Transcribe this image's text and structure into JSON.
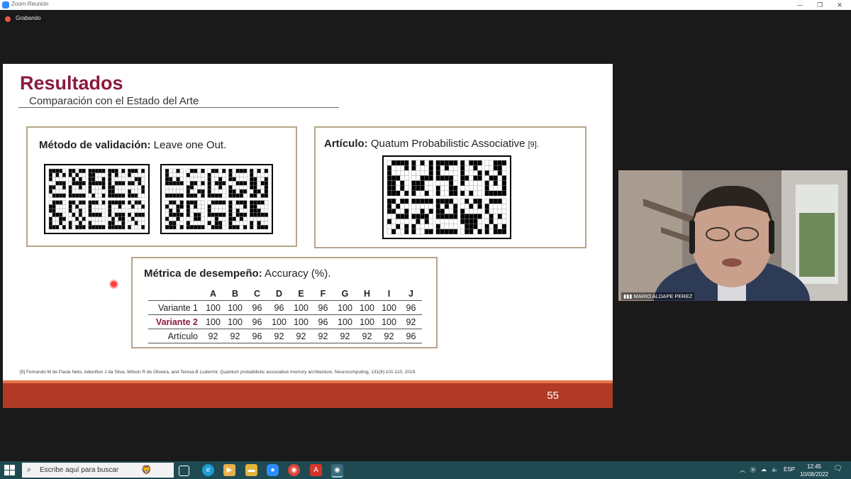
{
  "window": {
    "title": "Zoom Reunión",
    "minimize": "—",
    "restore": "❐",
    "close": "✕"
  },
  "recording": {
    "label": "Grabando"
  },
  "slide": {
    "title": "Resultados",
    "subtitle": "Comparación con el Estado del Arte",
    "validation": {
      "label": "Método de validación:",
      "value": " Leave one Out."
    },
    "article": {
      "label": "Artículo:",
      "value": " Quatum Probabilistic Associative ",
      "ref": "[9]."
    },
    "metric": {
      "label": "Métrica de desempeño:",
      "value": " Accuracy (%)."
    },
    "table": {
      "columns": [
        "A",
        "B",
        "C",
        "D",
        "E",
        "F",
        "G",
        "H",
        "I",
        "J"
      ],
      "rows": [
        {
          "label": "Variante 1",
          "values": [
            "100",
            "100",
            "96",
            "96",
            "100",
            "96",
            "100",
            "100",
            "100",
            "96"
          ]
        },
        {
          "label": "Variante 2",
          "values": [
            "100",
            "100",
            "96",
            "100",
            "100",
            "96",
            "100",
            "100",
            "100",
            "92"
          ]
        },
        {
          "label": "Artículo",
          "values": [
            "92",
            "92",
            "96",
            "92",
            "92",
            "92",
            "92",
            "92",
            "92",
            "96"
          ]
        }
      ]
    },
    "reference": "[9] Fernando M de Paula Neto, Adenilton J da Silva, Wilson R de Oliveira, and Teresa B Ludermir. Quantum probabilistic associative memory architecture. Neurocomputing, 131(8):101-110, 2019.",
    "page_number": "55"
  },
  "video": {
    "participant_name": "MARIO ALDAPE PEREZ"
  },
  "taskbar": {
    "search_placeholder": "Escribe aquí para buscar",
    "language": "ESP",
    "time": "12:45",
    "date": "10/08/2022",
    "notification_count": "1"
  },
  "colors": {
    "title": "#8b1a3d",
    "box_border": "#b5a58a",
    "footer": "#b03a25",
    "footer_accent": "#e8774b",
    "taskbar": "#1f4a52"
  }
}
